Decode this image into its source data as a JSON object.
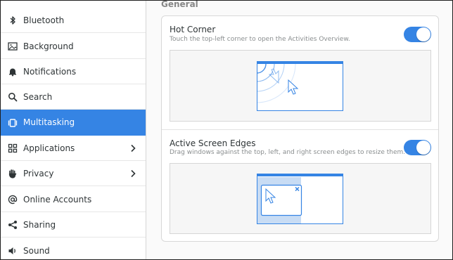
{
  "sidebar": {
    "items": [
      {
        "label": "Bluetooth",
        "icon": "bluetooth-icon"
      },
      {
        "label": "Background",
        "icon": "background-icon"
      },
      {
        "label": "Notifications",
        "icon": "bell-icon"
      },
      {
        "label": "Search",
        "icon": "search-icon"
      },
      {
        "label": "Multitasking",
        "icon": "multitasking-icon",
        "active": true
      },
      {
        "label": "Applications",
        "icon": "apps-grid-icon",
        "has_chevron": true
      },
      {
        "label": "Privacy",
        "icon": "hand-icon",
        "has_chevron": true
      },
      {
        "label": "Online Accounts",
        "icon": "at-icon"
      },
      {
        "label": "Sharing",
        "icon": "share-icon"
      },
      {
        "label": "Sound",
        "icon": "speaker-icon"
      }
    ]
  },
  "main": {
    "section_title": "General",
    "options": [
      {
        "title": "Hot Corner",
        "subtitle": "Touch the top-left corner to open the Activities Overview.",
        "enabled": true
      },
      {
        "title": "Active Screen Edges",
        "subtitle": "Drag windows against the top, left, and right screen edges to resize them.",
        "enabled": true
      }
    ]
  },
  "colors": {
    "accent": "#3584e4",
    "preview_blue": "#5aa0e8",
    "preview_light": "#c8dcf4"
  }
}
